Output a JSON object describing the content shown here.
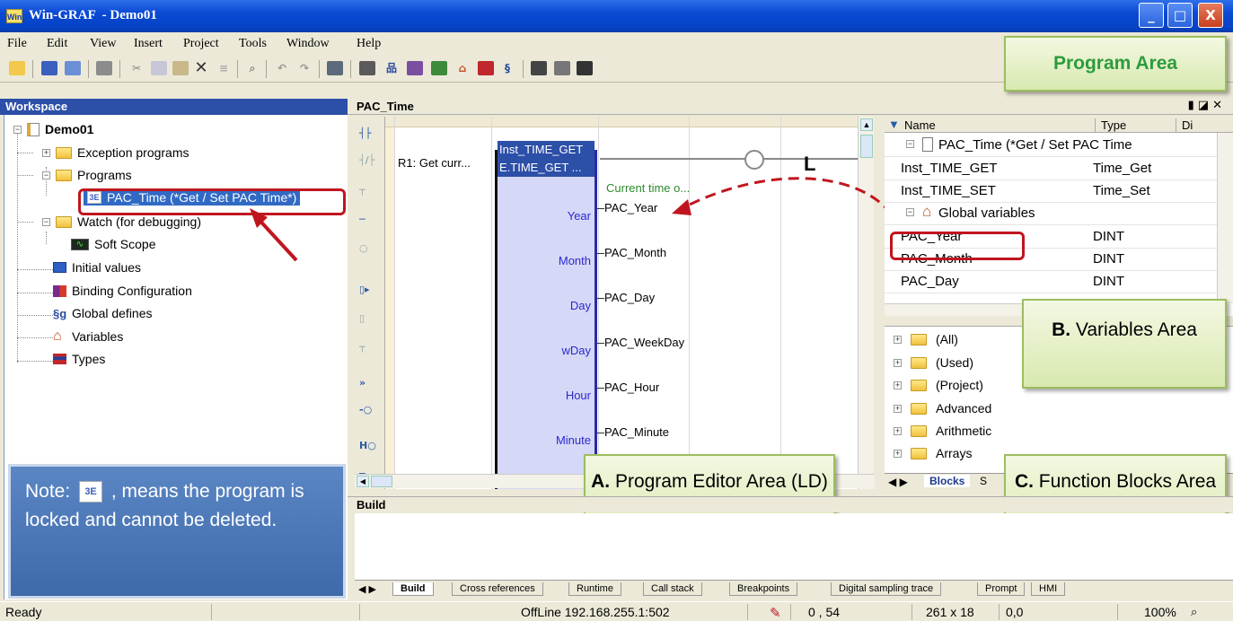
{
  "app": {
    "logo": "Win",
    "title": "Win-GRAF  - Demo01",
    "win_min": "_",
    "win_max": "□",
    "win_close": "X"
  },
  "menu": [
    "File",
    "Edit",
    "View",
    "Insert",
    "Project",
    "Tools",
    "Window",
    "Help"
  ],
  "workspace": {
    "title": "Workspace",
    "root": "Demo01",
    "items": {
      "exception": "Exception programs",
      "programs": "Programs",
      "pac_time": "PAC_Time (*Get / Set PAC Time*)",
      "watch": "Watch (for debugging)",
      "soft_scope": "Soft Scope",
      "initial_values": "Initial values",
      "binding": "Binding Configuration",
      "global_defines": "Global defines",
      "variables": "Variables",
      "types": "Types"
    }
  },
  "note": {
    "prefix": "Note:",
    "suffix": ", means the program is locked and cannot be deleted."
  },
  "editor": {
    "title": "PAC_Time",
    "rung_label": "R1: Get curr...",
    "fb_instance": "Inst_TIME_GET",
    "fb_type": "E.TIME_GET ...",
    "comment": "Current time o...",
    "coil": "L",
    "pins": [
      {
        "pin": "Year",
        "var": "PAC_Year"
      },
      {
        "pin": "Month",
        "var": "PAC_Month"
      },
      {
        "pin": "Day",
        "var": "PAC_Day"
      },
      {
        "pin": "wDay",
        "var": "PAC_WeekDay"
      },
      {
        "pin": "Hour",
        "var": "PAC_Hour"
      },
      {
        "pin": "Minute",
        "var": "PAC_Minute"
      }
    ]
  },
  "vars": {
    "columns": {
      "name": "Name",
      "type": "Type",
      "dim": "Di"
    },
    "group_program": "PAC_Time (*Get / Set PAC Time",
    "program_rows": [
      {
        "name": "Inst_TIME_GET",
        "type": "Time_Get"
      },
      {
        "name": "Inst_TIME_SET",
        "type": "Time_Set"
      }
    ],
    "group_global": "Global variables",
    "global_rows": [
      {
        "name": "PAC_Year",
        "type": "DINT"
      },
      {
        "name": "PAC_Month",
        "type": "DINT"
      },
      {
        "name": "PAC_Day",
        "type": "DINT"
      }
    ]
  },
  "blocks": {
    "items": [
      "(All)",
      "(Used)",
      "(Project)",
      "Advanced",
      "Arithmetic",
      "Arrays"
    ],
    "tab_active": "Blocks",
    "tab_other": "S"
  },
  "build": {
    "title": "Build",
    "tabs": [
      "Build",
      "Cross references",
      "Runtime",
      "Call stack",
      "Breakpoints",
      "Digital sampling trace",
      "Prompt",
      "HMI"
    ]
  },
  "status": {
    "ready": "Ready",
    "connection": "OffLine 192.168.255.1:502",
    "pos": "0 , 54",
    "size": "261 x 18",
    "coord": "0,0",
    "zoom": "100%"
  },
  "callouts": {
    "program_area": "Program Area",
    "variables_area_bold": "B.",
    "variables_area": "Variables Area",
    "editor_area_bold": "A.",
    "editor_area": "Program Editor Area (LD)",
    "blocks_area_bold": "C.",
    "blocks_area": "Function Blocks Area"
  }
}
